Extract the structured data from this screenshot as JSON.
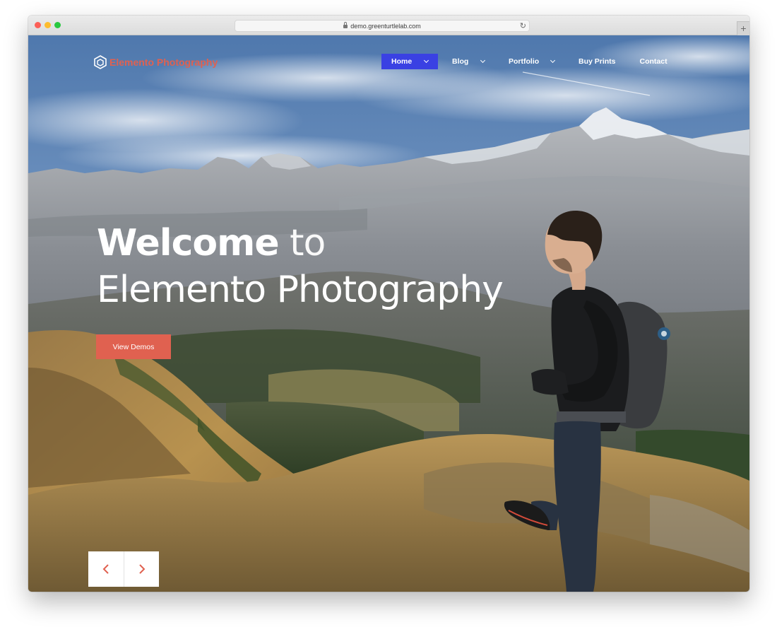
{
  "browser": {
    "url": "demo.greenturtlelab.com",
    "new_tab_symbol": "+",
    "reload_symbol": "↻"
  },
  "site": {
    "logo_text": "Elemento Photography",
    "brand_color": "#e06150",
    "accent_color": "#3a41e3"
  },
  "nav": {
    "items": [
      {
        "label": "Home",
        "active": true,
        "has_dropdown": true
      },
      {
        "label": "Blog",
        "active": false,
        "has_dropdown": true
      },
      {
        "label": "Portfolio",
        "active": false,
        "has_dropdown": true
      },
      {
        "label": "Buy Prints",
        "active": false,
        "has_dropdown": false
      },
      {
        "label": "Contact",
        "active": false,
        "has_dropdown": false
      }
    ]
  },
  "hero": {
    "headline_bold": "Welcome",
    "headline_rest": "to",
    "headline_line2": "Elemento Photography",
    "cta_label": "View Demos",
    "background": "mountain landscape with hiker",
    "prev_icon": "chevron-left-icon",
    "next_icon": "chevron-right-icon"
  }
}
